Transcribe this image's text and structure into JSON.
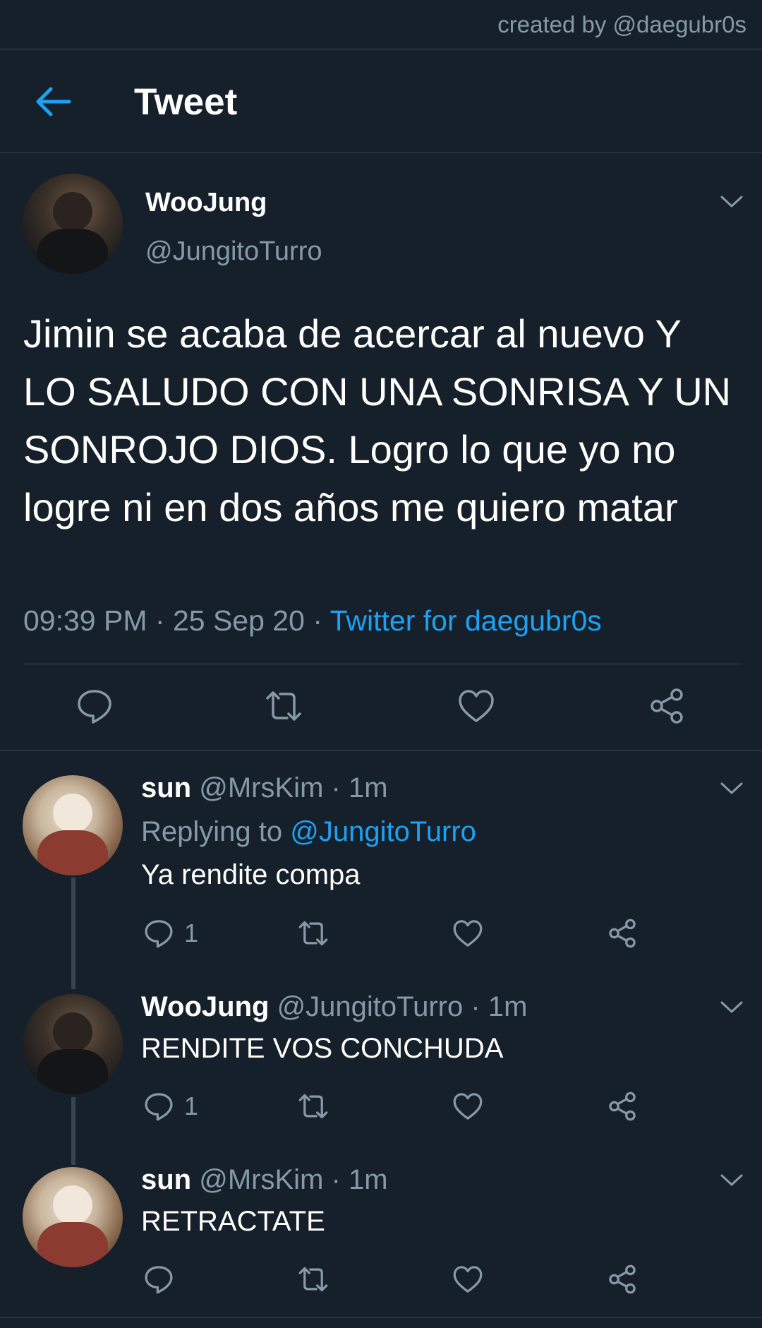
{
  "watermark": "created by @daegubr0s",
  "header": {
    "title": "Tweet",
    "back_icon": "arrow-left-icon"
  },
  "colors": {
    "background": "#15202b",
    "accent": "#1da1f2",
    "muted": "#8899a6",
    "divider": "#38444d"
  },
  "main_tweet": {
    "name": "WooJung",
    "handle": "@JungitoTurro",
    "text": "Jimin se acaba de acercar al nuevo Y LO SALUDO CON UNA SONRISA Y UN SONROJO DIOS. Logro lo que yo no logre ni en dos años me quiero matar",
    "time": "09:39 PM",
    "date": "25 Sep 20",
    "separator": "·",
    "source": "Twitter for daegubr0s"
  },
  "replies": [
    {
      "name": "sun",
      "handle": "@MrsKim",
      "time": "1m",
      "replying_label": "Replying to",
      "replying_to": "@JungitoTurro",
      "text": "Ya rendite compa",
      "reply_count": "1"
    },
    {
      "name": "WooJung",
      "handle": "@JungitoTurro",
      "time": "1m",
      "text": "RENDITE VOS CONCHUDA",
      "reply_count": "1"
    },
    {
      "name": "sun",
      "handle": "@MrsKim",
      "time": "1m",
      "text": "RETRACTATE",
      "reply_count": ""
    }
  ]
}
